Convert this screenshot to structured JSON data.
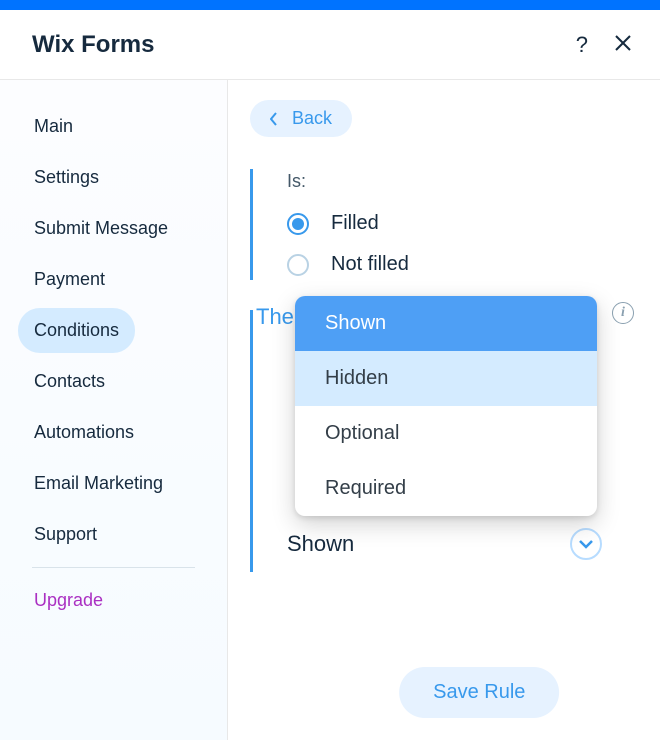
{
  "header": {
    "title": "Wix Forms"
  },
  "sidebar": {
    "items": [
      {
        "label": "Main"
      },
      {
        "label": "Settings"
      },
      {
        "label": "Submit Message"
      },
      {
        "label": "Payment"
      },
      {
        "label": "Conditions"
      },
      {
        "label": "Contacts"
      },
      {
        "label": "Automations"
      },
      {
        "label": "Email Marketing"
      },
      {
        "label": "Support"
      }
    ],
    "active_index": 4,
    "upgrade_label": "Upgrade"
  },
  "main": {
    "back_label": "Back",
    "is_label": "Is:",
    "radio": {
      "options": [
        {
          "label": "Filled",
          "checked": true
        },
        {
          "label": "Not filled",
          "checked": false
        }
      ]
    },
    "then_label": "Then",
    "select": {
      "value": "Shown"
    },
    "dropdown": {
      "options": [
        {
          "label": "Shown",
          "state": "selected"
        },
        {
          "label": "Hidden",
          "state": "hover"
        },
        {
          "label": "Optional",
          "state": ""
        },
        {
          "label": "Required",
          "state": ""
        }
      ]
    },
    "save_label": "Save Rule"
  }
}
